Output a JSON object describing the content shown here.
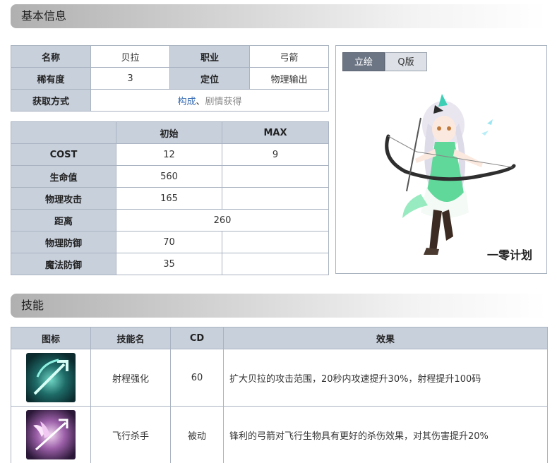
{
  "sections": {
    "basic_info": "基本信息",
    "skills": "技能"
  },
  "info": {
    "name_label": "名称",
    "name_value": "贝拉",
    "class_label": "职业",
    "class_value": "弓箭",
    "rarity_label": "稀有度",
    "rarity_value": "3",
    "role_label": "定位",
    "role_value": "物理输出",
    "obtain_label": "获取方式",
    "obtain_link": "构成",
    "obtain_sep": "、",
    "obtain_other": "剧情获得"
  },
  "stats": {
    "col_initial": "初始",
    "col_max": "MAX",
    "rows": [
      {
        "label": "COST",
        "initial": "12",
        "max": "9"
      },
      {
        "label": "生命值",
        "initial": "560",
        "max": ""
      },
      {
        "label": "物理攻击",
        "initial": "165",
        "max": ""
      },
      {
        "label": "距离",
        "merged": "260"
      },
      {
        "label": "物理防御",
        "initial": "70",
        "max": ""
      },
      {
        "label": "魔法防御",
        "initial": "35",
        "max": ""
      }
    ]
  },
  "portrait": {
    "tab_art": "立绘",
    "tab_q": "Q版",
    "logo_text": "一零计划"
  },
  "skills": {
    "col_icon": "图标",
    "col_name": "技能名",
    "col_cd": "CD",
    "col_effect": "效果",
    "rows": [
      {
        "name": "射程强化",
        "cd": "60",
        "effect": "扩大贝拉的攻击范围，20秒内攻速提升30%，射程提升100码",
        "icon": "arrow-range-icon"
      },
      {
        "name": "飞行杀手",
        "cd": "被动",
        "effect": "锋利的弓箭对飞行生物具有更好的杀伤效果，对其伤害提升20%",
        "icon": "winged-arrow-icon"
      }
    ]
  }
}
